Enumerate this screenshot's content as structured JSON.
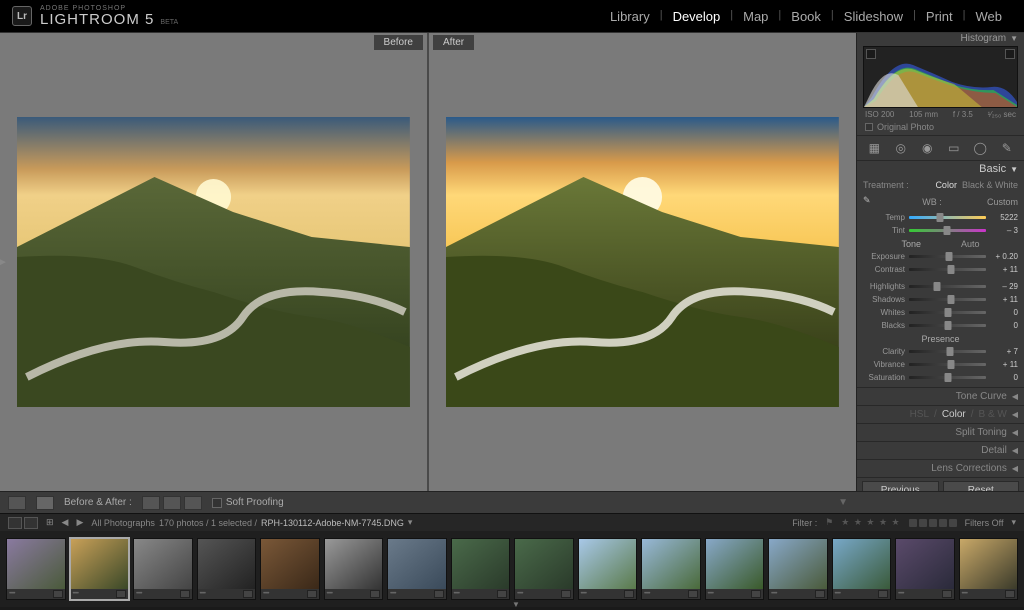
{
  "header": {
    "badge": "Lr",
    "sup": "ADOBE PHOTOSHOP",
    "main": "LIGHTROOM 5",
    "beta": "BETA",
    "modules": [
      "Library",
      "Develop",
      "Map",
      "Book",
      "Slideshow",
      "Print",
      "Web"
    ],
    "active_module": "Develop"
  },
  "preview": {
    "before_label": "Before",
    "after_label": "After"
  },
  "toolbar": {
    "loupe_tip": "Loupe",
    "compare_tip": "Before/After",
    "before_after_label": "Before & After :",
    "soft_proof": "Soft Proofing"
  },
  "right": {
    "histogram_title": "Histogram",
    "hist_meta": {
      "iso": "ISO 200",
      "focal": "105 mm",
      "f": "f / 3.5",
      "exp": "¹⁄₂₅₀ sec"
    },
    "original_photo": "Original Photo",
    "basic": {
      "title": "Basic",
      "treatment_label": "Treatment :",
      "treat_color": "Color",
      "treat_bw": "Black & White",
      "wb_label": "WB :",
      "wb_value": "Custom",
      "temp_label": "Temp",
      "temp_val": "5222",
      "tint_label": "Tint",
      "tint_val": "– 3",
      "tone_label": "Tone",
      "auto": "Auto",
      "exposure_label": "Exposure",
      "exposure_val": "+ 0.20",
      "contrast_label": "Contrast",
      "contrast_val": "+ 11",
      "highlights_label": "Highlights",
      "highlights_val": "– 29",
      "shadows_label": "Shadows",
      "shadows_val": "+ 11",
      "whites_label": "Whites",
      "whites_val": "0",
      "blacks_label": "Blacks",
      "blacks_val": "0",
      "presence_label": "Presence",
      "clarity_label": "Clarity",
      "clarity_val": "+ 7",
      "vibrance_label": "Vibrance",
      "vibrance_val": "+ 11",
      "saturation_label": "Saturation",
      "saturation_val": "0"
    },
    "panels": {
      "tone_curve": "Tone Curve",
      "hsl": "HSL",
      "color": "Color",
      "bw": "B & W",
      "split": "Split Toning",
      "detail": "Detail",
      "lens": "Lens Corrections"
    },
    "previous": "Previous",
    "reset": "Reset"
  },
  "sec": {
    "source": "All Photographs",
    "count": "170 photos / 1 selected /",
    "filename": "RPH-130112-Adobe-NM-7745.DNG",
    "filter_label": "Filter :",
    "filters_off": "Filters Off"
  },
  "thumbs": {
    "count": 16,
    "selected_index": 1
  }
}
